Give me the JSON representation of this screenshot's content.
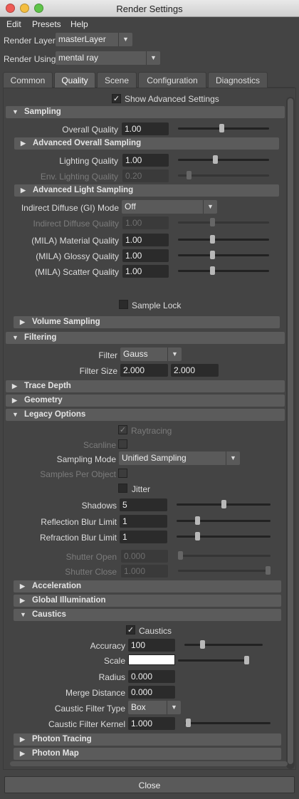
{
  "window": {
    "title": "Render Settings"
  },
  "menu": [
    "Edit",
    "Presets",
    "Help"
  ],
  "render_layer": {
    "label": "Render Layer",
    "value": "masterLayer"
  },
  "render_using": {
    "label": "Render Using",
    "value": "mental ray"
  },
  "tabs": [
    "Common",
    "Quality",
    "Scene",
    "Configuration",
    "Diagnostics"
  ],
  "active_tab": "Quality",
  "show_advanced": {
    "label": "Show Advanced Settings",
    "checked": true
  },
  "sections": {
    "sampling": "Sampling",
    "adv_overall": "Advanced Overall Sampling",
    "adv_light": "Advanced Light Sampling",
    "volume": "Volume Sampling",
    "filtering": "Filtering",
    "trace_depth": "Trace Depth",
    "geometry": "Geometry",
    "legacy": "Legacy Options",
    "acceleration": "Acceleration",
    "gi": "Global Illumination",
    "caustics": "Caustics",
    "photon_tracing": "Photon Tracing",
    "photon_map": "Photon Map"
  },
  "sampling": {
    "overall_quality": {
      "label": "Overall Quality",
      "value": "1.00",
      "level": 0.5
    },
    "lighting_quality": {
      "label": "Lighting Quality",
      "value": "1.00",
      "level": 0.4
    },
    "env_lighting_quality": {
      "label": "Env. Lighting Quality",
      "value": "0.20",
      "level": 0.12
    },
    "gi_mode": {
      "label": "Indirect Diffuse (GI) Mode",
      "value": "Off"
    },
    "indirect_diffuse_quality": {
      "label": "Indirect Diffuse Quality",
      "value": "1.00",
      "level": 0.4
    },
    "material_quality": {
      "label": "(MILA) Material Quality",
      "value": "1.00",
      "level": 0.4
    },
    "glossy_quality": {
      "label": "(MILA) Glossy Quality",
      "value": "1.00",
      "level": 0.4
    },
    "scatter_quality": {
      "label": "(MILA) Scatter Quality",
      "value": "1.00",
      "level": 0.4
    },
    "sample_lock": {
      "label": "Sample Lock",
      "checked": false
    }
  },
  "filtering": {
    "filter": {
      "label": "Filter",
      "value": "Gauss"
    },
    "filter_size": {
      "label": "Filter Size",
      "x": "2.000",
      "y": "2.000"
    }
  },
  "legacy": {
    "raytracing": {
      "label": "Raytracing",
      "checked": true
    },
    "scanline": {
      "label": "Scanline",
      "checked": false
    },
    "sampling_mode": {
      "label": "Sampling Mode",
      "value": "Unified Sampling"
    },
    "samples_per_object": {
      "label": "Samples Per Object",
      "checked": false
    },
    "jitter": {
      "label": "Jitter",
      "checked": false
    },
    "shadows": {
      "label": "Shadows",
      "value": "5",
      "level": 0.5
    },
    "reflection_blur": {
      "label": "Reflection Blur Limit",
      "value": "1",
      "level": 0.2
    },
    "refraction_blur": {
      "label": "Refraction Blur Limit",
      "value": "1",
      "level": 0.2
    },
    "shutter_open": {
      "label": "Shutter Open",
      "value": "0.000",
      "level": 0.0
    },
    "shutter_close": {
      "label": "Shutter Close",
      "value": "1.000",
      "level": 1.0
    }
  },
  "caustics": {
    "enable": {
      "label": "Caustics",
      "checked": true
    },
    "accuracy": {
      "label": "Accuracy",
      "value": "100",
      "level": 0.2
    },
    "scale": {
      "label": "Scale",
      "color": "#ffffff",
      "level": 1.0
    },
    "radius": {
      "label": "Radius",
      "value": "0.000"
    },
    "merge_distance": {
      "label": "Merge Distance",
      "value": "0.000"
    },
    "filter_type": {
      "label": "Caustic Filter Type",
      "value": "Box"
    },
    "filter_kernel": {
      "label": "Caustic Filter Kernel",
      "value": "1.000",
      "level": 0.0
    }
  },
  "close_button": "Close"
}
